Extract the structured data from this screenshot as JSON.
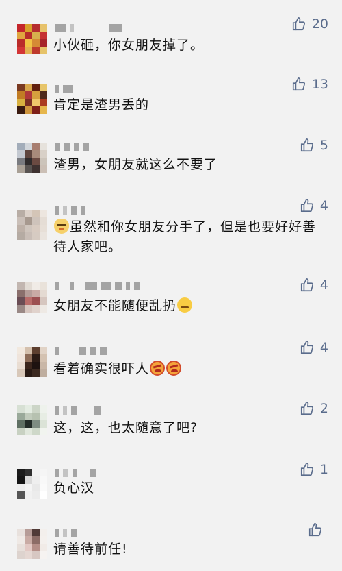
{
  "colors": {
    "background": "#f2f2f2",
    "text": "#111111",
    "like": "#5a6c8c"
  },
  "comments": [
    {
      "content": "小伙砸，你女朋友掉了。",
      "likes": "20",
      "like_icon": "thumb-up-icon"
    },
    {
      "content": "肯定是渣男丢的",
      "likes": "13",
      "like_icon": "thumb-up-icon"
    },
    {
      "content": "渣男，女朋友就这么不要了",
      "likes": "5",
      "like_icon": "thumb-up-icon"
    },
    {
      "emoji": "smug-cat-emoji",
      "content": "虽然和你女朋友分手了，但是也要好好善待人家吧。",
      "likes": "4",
      "like_icon": "thumb-up-icon"
    },
    {
      "content": "女朋友不能随便乱扔",
      "emoji": "thinking-emoji",
      "likes": "4",
      "like_icon": "thumb-up-icon"
    },
    {
      "content": "看着确实很吓人",
      "emoji": "angry-emoji",
      "likes": "4",
      "like_icon": "thumb-up-icon"
    },
    {
      "content": "这，这，也太随意了吧?",
      "likes": "2",
      "like_icon": "thumb-up-icon"
    },
    {
      "content": "负心汉",
      "likes": "1",
      "like_icon": "thumb-up-icon"
    },
    {
      "content": "请善待前任!",
      "likes": "",
      "like_icon": "thumb-up-icon"
    }
  ]
}
